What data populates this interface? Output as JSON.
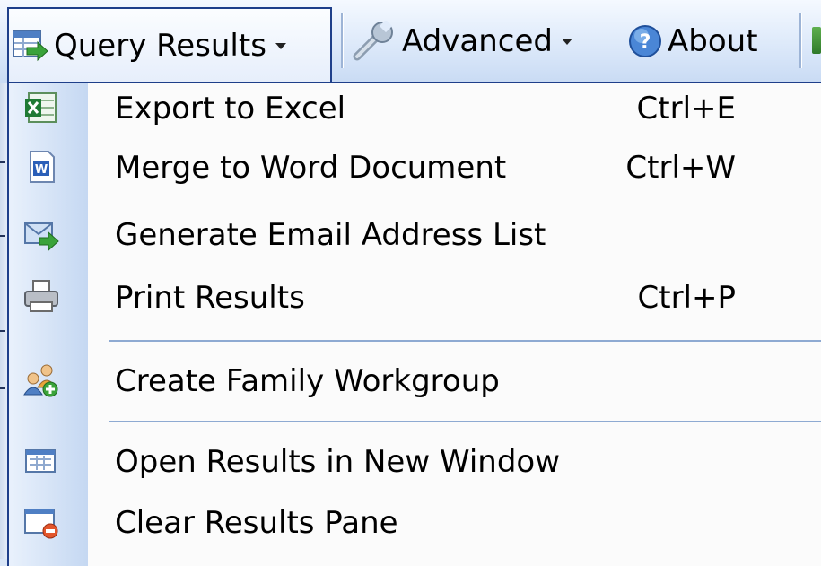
{
  "toolbar": {
    "query_results": {
      "label": "Query Results",
      "icon": "grid-arrow-icon"
    },
    "advanced": {
      "label": "Advanced",
      "icon": "wrench-icon"
    },
    "about": {
      "label": "About",
      "icon": "help-circle-icon"
    }
  },
  "menu": {
    "items": [
      {
        "label": "Export to Excel",
        "shortcut": "Ctrl+E",
        "icon": "excel-icon"
      },
      {
        "label": "Merge to Word Document",
        "shortcut": "Ctrl+W",
        "icon": "word-icon"
      },
      {
        "label": "Generate Email Address List",
        "shortcut": "",
        "icon": "email-arrow-icon"
      },
      {
        "label": "Print Results",
        "shortcut": "Ctrl+P",
        "icon": "printer-icon"
      },
      {
        "label": "Create Family Workgroup",
        "shortcut": "",
        "icon": "family-group-icon"
      },
      {
        "label": "Open Results in New Window",
        "shortcut": "",
        "icon": "new-window-icon"
      },
      {
        "label": "Clear Results Pane",
        "shortcut": "",
        "icon": "clear-pane-icon"
      }
    ]
  },
  "colors": {
    "menu_border": "#1e3f8a",
    "separator": "#8eaad2",
    "gutter": "#c5d8f2",
    "toolbar": "#e1ecfb"
  }
}
